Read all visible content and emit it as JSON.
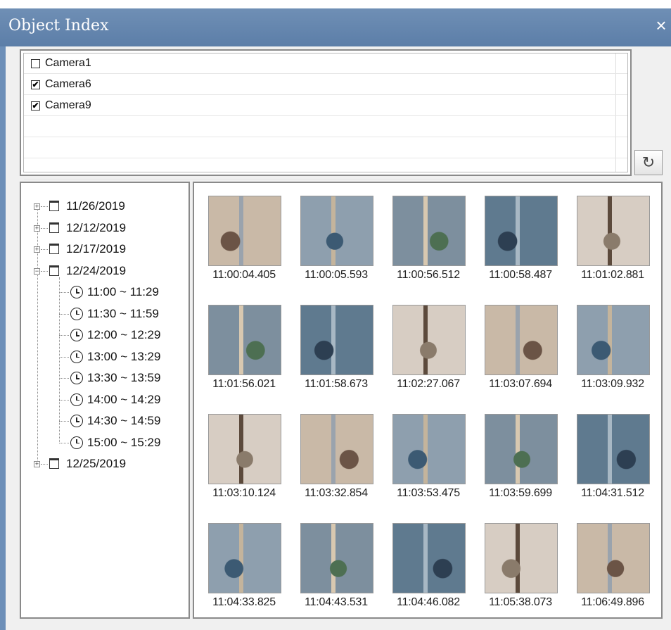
{
  "window": {
    "title": "Object Index",
    "close_icon": "×"
  },
  "cameras": [
    {
      "label": "Camera1",
      "checked": false
    },
    {
      "label": "Camera6",
      "checked": true
    },
    {
      "label": "Camera9",
      "checked": true
    }
  ],
  "refresh_icon": "↻",
  "tree": {
    "dates": [
      "11/26/2019",
      "12/12/2019",
      "12/17/2019",
      "12/24/2019",
      "12/25/2019"
    ],
    "expanded_date": "12/24/2019",
    "time_ranges": [
      "11:00 ~ 11:29",
      "11:30 ~ 11:59",
      "12:00 ~ 12:29",
      "13:00 ~ 13:29",
      "13:30 ~ 13:59",
      "14:00 ~ 14:29",
      "14:30 ~ 14:59",
      "15:00 ~ 15:29"
    ]
  },
  "thumbnails": [
    "11:00:04.405",
    "11:00:05.593",
    "11:00:56.512",
    "11:00:58.487",
    "11:01:02.881",
    "11:01:56.021",
    "11:01:58.673",
    "11:02:27.067",
    "11:03:07.694",
    "11:03:09.932",
    "11:03:10.124",
    "11:03:32.854",
    "11:03:53.475",
    "11:03:59.699",
    "11:04:31.512",
    "11:04:33.825",
    "11:04:43.531",
    "11:04:46.082",
    "11:05:38.073",
    "11:06:49.896"
  ],
  "colors": {
    "titlebar": "#5c7ea8",
    "panel_border": "#8a8a8a"
  }
}
